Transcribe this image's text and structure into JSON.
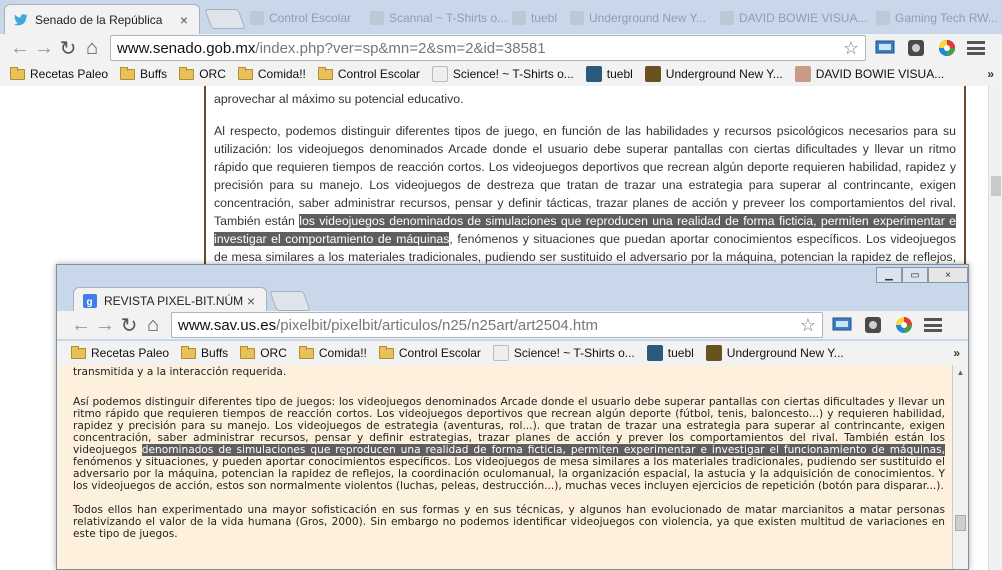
{
  "window_back": {
    "tab_title": "Senado de la República",
    "ghost_tabs": [
      "Control Escolar",
      "Scannal ~ T-Shirts o...",
      "tuebl",
      "Underground New Y...",
      "DAVID BOWIE VISUA...",
      "Gaming Tech RW..."
    ],
    "url_host": "www.senado.gob.mx",
    "url_path": "/index.php?ver=sp&mn=2&sm=2&id=38581",
    "bookmarks": [
      "Recetas Paleo",
      "Buffs",
      "ORC",
      "Comida!!",
      "Control Escolar",
      "Science! ~ T-Shirts o...",
      "tuebl",
      "Underground New Y...",
      "DAVID BOWIE VISUA..."
    ],
    "para_top": "aprovechar al máximo su potencial educativo.",
    "para_main_before": "Al respecto, podemos distinguir diferentes tipos de juego, en función de las habilidades y recursos psicológicos necesarios para su utilización: los videojuegos denominados Arcade donde el usuario debe superar pantallas con ciertas dificultades y llevar un ritmo rápido que requieren tiempos de reacción cortos. Los videojuegos deportivos que recrean algún deporte requieren habilidad, rapidez y precisión para su manejo. Los videojuegos de destreza que tratan de trazar una estrategia para superar al contrincante, exigen concentración, saber administrar recursos, pensar y definir tácticas, trazar planes de acción y preveer los comportamientos del rival. También están ",
    "para_main_highlight": "los videojuegos denominados de simulaciones que reproducen una realidad de forma ficticia, permiten experimentar e investigar el comportamiento de máquinas",
    "para_main_after": ", fenómenos y situaciones que puedan aportar conocimientos específicos. Los videojuegos de mesa similares a los materiales tradicionales, pudiendo ser sustituido el adversario por la máquina, potencian la rapidez de reflejos, la coordinación oculomanual, la organización espacial, la astucia y la adquisición de conocimientos."
  },
  "window_front": {
    "tab_title": "REVISTA PIXEL-BIT.NÚMERO",
    "tab_close": "×",
    "url_host": "www.sav.us.es",
    "url_path": "/pixelbit/pixelbit/articulos/n25/n25art/art2504.htm",
    "bookmarks": [
      "Recetas Paleo",
      "Buffs",
      "ORC",
      "Comida!!",
      "Control Escolar",
      "Science! ~ T-Shirts o...",
      "tuebl",
      "Underground New Y..."
    ],
    "para_top": "transmitida y a la interacción requerida.",
    "para_a_before": "Así podemos distinguir diferentes tipo de juegos: los videojuegos denominados Arcade donde el usuario debe superar pantallas con ciertas dificultades y llevar un ritmo rápido que requieren tiempos de reacción cortos. Los videojuegos deportivos que recrean algún deporte (fútbol, tenis, baloncesto...) y requieren habilidad, rapidez y precisión para su manejo. Los videojuegos de estrategia (aventuras, rol...). que tratan de trazar una estrategia para superar al contrincante, exigen concentración, saber administrar recursos, pensar y definir estrategias, trazar planes de acción y prever los comportamientos del rival. También están los videojuegos ",
    "para_a_highlight": "denominados de simulaciones que reproducen una realidad de forma ficticia, permiten experimentar e investigar el funcionamiento de máquinas,",
    "para_a_after": " fenómenos y situaciones, y pueden aportar conocimientos específicos. Los videojuegos de mesa similares a los materiales tradicionales, pudiendo ser sustituido el adversario por la máquina, potencian la rapidez de reflejos, la coordinación oculomanual, la organización espacial, la astucia y la adquisición de conocimientos. Y los videojuegos de acción, estos son normalmente violentos (luchas, peleas, destrucción...), muchas veces incluyen ejercicios de repetición (botón para disparar...).",
    "para_b": "Todos ellos han experimentado una mayor sofisticación en sus formas y en sus técnicas, y algunos han evolucionado de matar marcianitos a matar personas relativizando el valor de la vida humana (Gros, 2000). Sin embargo no podemos identificar videojuegos con violencia, ya que existen multitud de variaciones en este tipo de juegos."
  },
  "icons": {
    "back": "←",
    "forward": "→",
    "reload": "↻",
    "home": "⌂",
    "star": "☆",
    "more": "»",
    "close": "×"
  },
  "colors": {
    "highlight_bg": "#5e5e5e",
    "page2_bg": "#fdf1de",
    "content_border": "#6b4a2c"
  }
}
